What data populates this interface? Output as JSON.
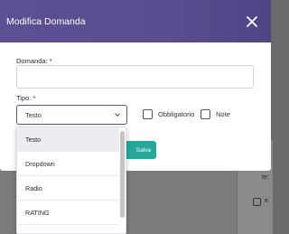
{
  "modal": {
    "title": "Modifica Domanda",
    "question_label": "Domanda: *",
    "question_value": "",
    "type_label": "Tipo: *",
    "type_selected": "Testo",
    "mandatory_label": "Obbligatorio",
    "notes_label": "Note",
    "save_label": "Salva",
    "save_icon": "pencil-icon"
  },
  "dropdown": {
    "options": [
      "Testo",
      "Dropdown",
      "Radio",
      "RATING"
    ]
  },
  "background": {
    "fragment_1": "I",
    "fragment_2": "te:",
    "fragment_3": "e"
  },
  "colors": {
    "header": "#5c4f93",
    "save_button": "#25a79a",
    "overlay": "#6a6a6a"
  }
}
